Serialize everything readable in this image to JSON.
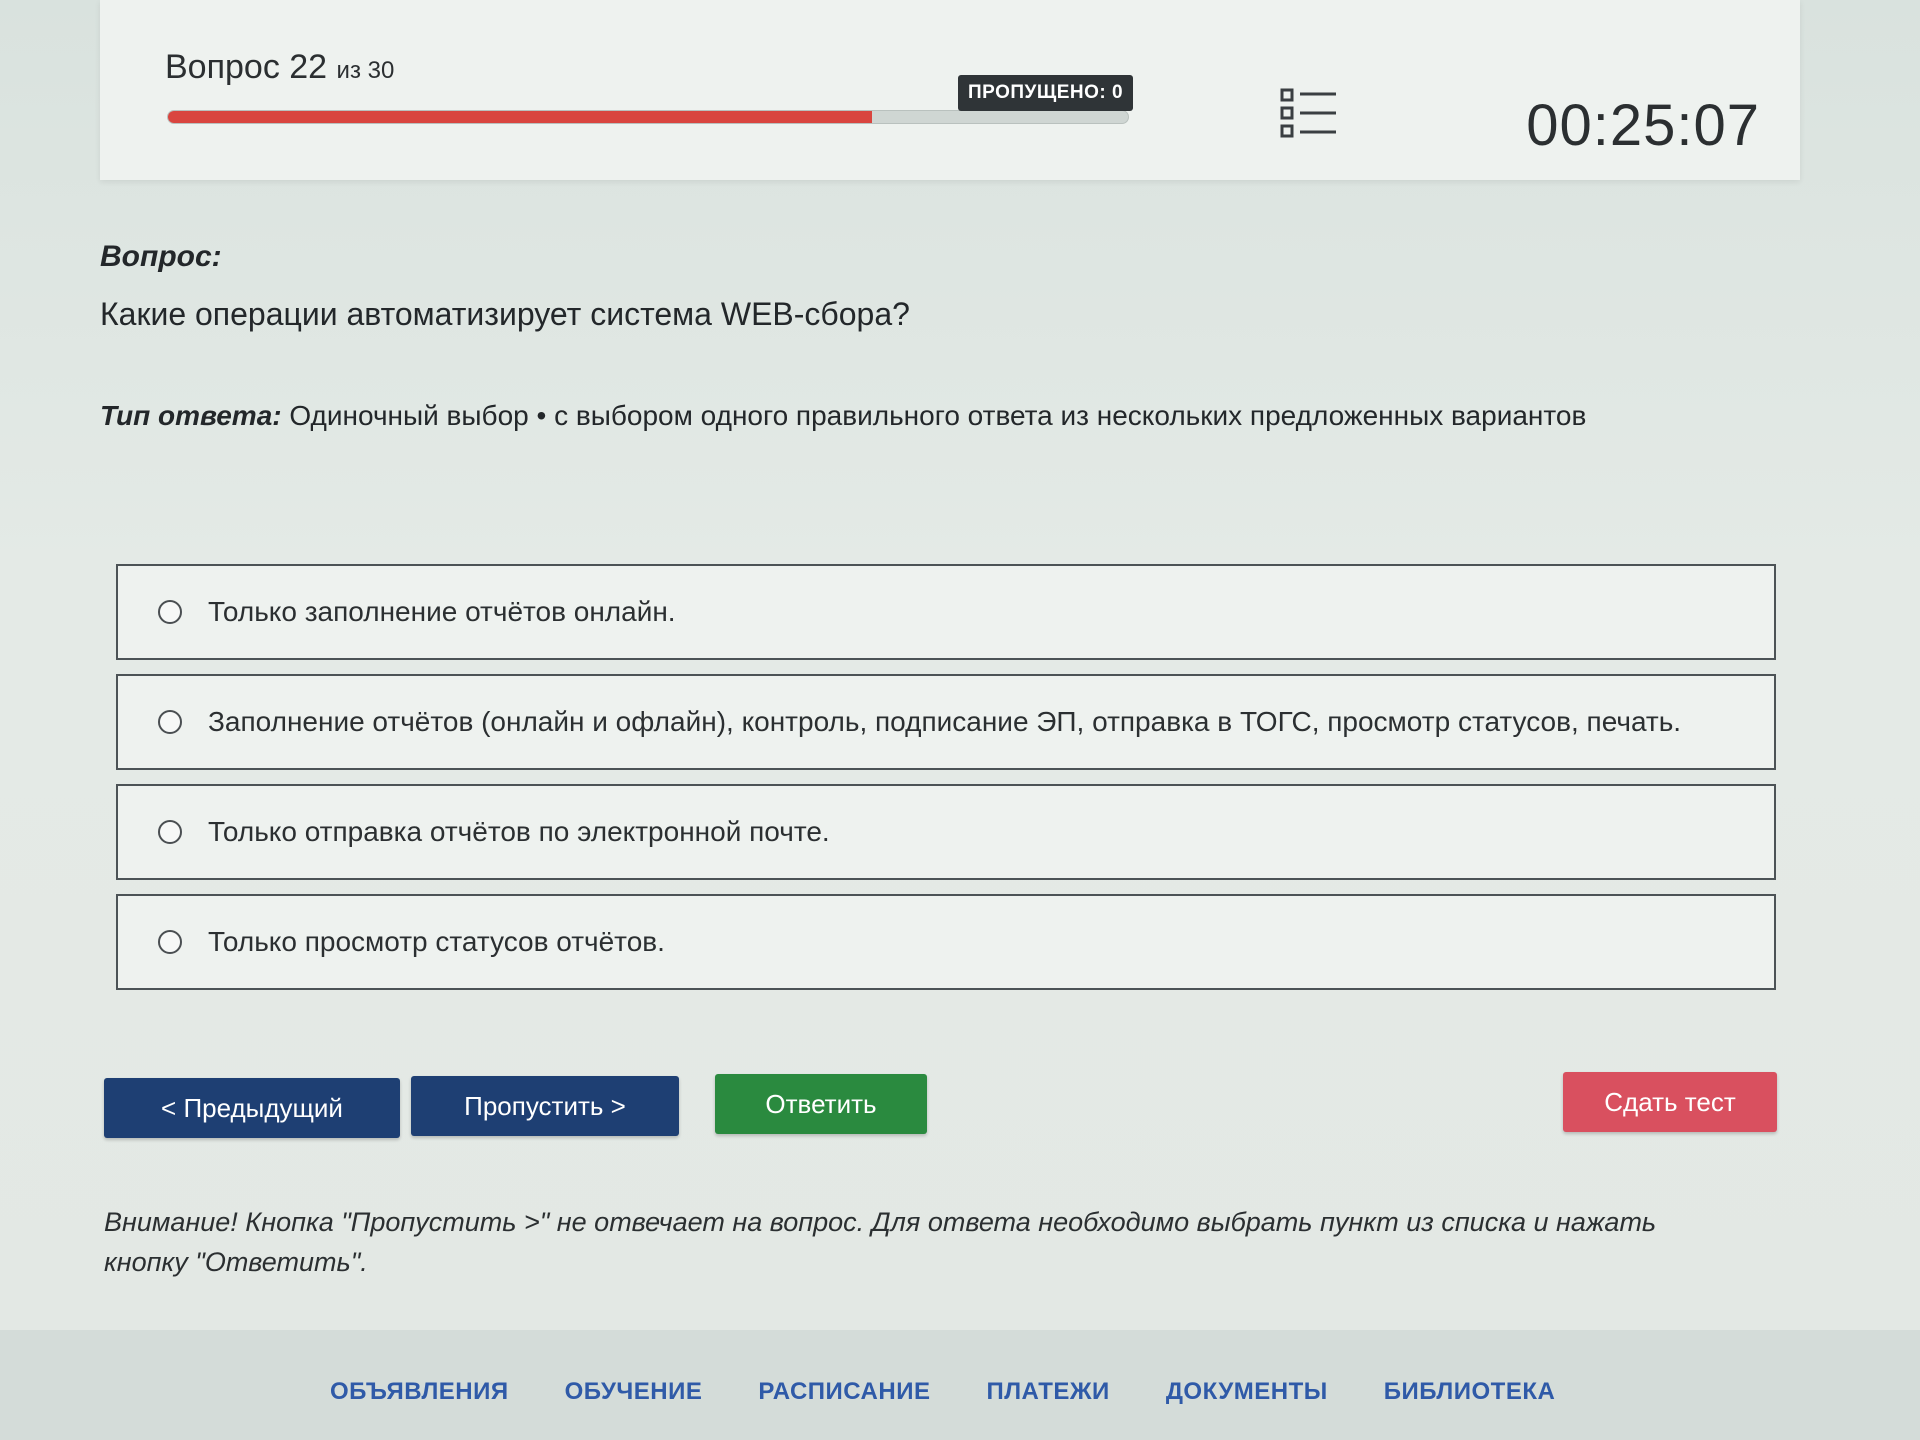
{
  "header": {
    "question_word": "Вопрос 22",
    "question_of": "из 30",
    "progress_fraction": 0.733,
    "skipped_label": "ПРОПУЩЕНО: 0",
    "timer": "00:25:07",
    "list_icon": "question-list-icon"
  },
  "question": {
    "heading": "Вопрос:",
    "text": "Какие операции автоматизирует система WEB-сбора?",
    "answer_type_label": "Тип ответа:",
    "answer_type_value": " Одиночный выбор • с выбором одного правильного ответа из нескольких предложенных вариантов"
  },
  "options": [
    "Только заполнение отчётов онлайн.",
    "Заполнение отчётов (онлайн и офлайн), контроль, подписание ЭП, отправка в ТОГС, просмотр статусов, печать.",
    "Только отправка отчётов по электронной почте.",
    "Только просмотр статусов отчётов."
  ],
  "buttons": {
    "prev": "< Предыдущий",
    "skip": "Пропустить >",
    "answer": "Ответить",
    "submit": "Сдать тест"
  },
  "notice": "Внимание! Кнопка \"Пропустить >\" не отвечает на вопрос. Для ответа необходимо выбрать пункт из списка и нажать кнопку \"Ответить\".",
  "footer_nav": [
    "ОБЪЯВЛЕНИЯ",
    "ОБУЧЕНИЕ",
    "РАСПИСАНИЕ",
    "ПЛАТЕЖИ",
    "ДОКУМЕНТЫ",
    "БИБЛИОТЕКА"
  ],
  "colors": {
    "progress": "#d9453f",
    "primary_button": "#1e3f73",
    "answer_button": "#2a8a3f",
    "submit_button": "#d9505f",
    "nav_link": "#2f5aa8"
  }
}
